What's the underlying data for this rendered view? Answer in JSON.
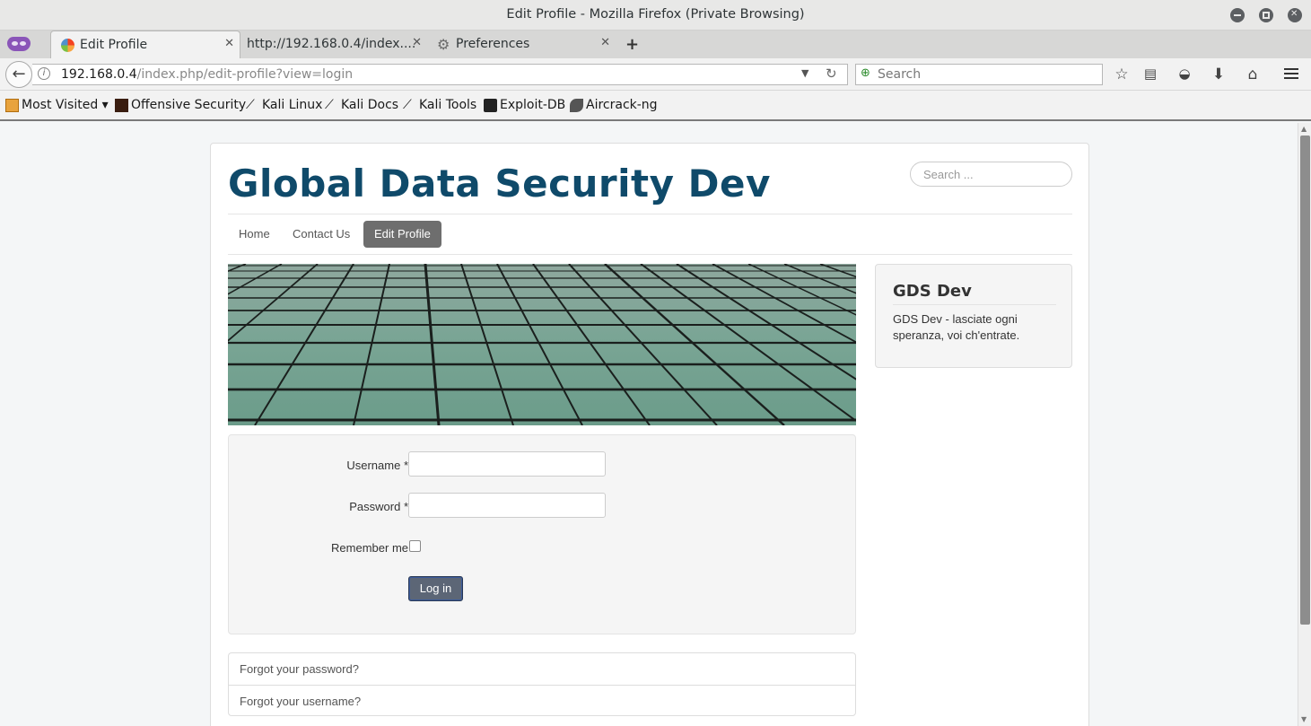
{
  "window": {
    "title": "Edit Profile - Mozilla Firefox (Private Browsing)"
  },
  "tabs": [
    {
      "label": "Edit Profile",
      "icon": "joomla-icon",
      "active": true
    },
    {
      "label": "http://192.168.0.4/index....",
      "active": false
    },
    {
      "label": "Preferences",
      "icon": "gear-icon",
      "active": false
    }
  ],
  "navbar": {
    "url_host": "192.168.0.4",
    "url_rest": "/index.php/edit-profile?view=login",
    "search_placeholder": "Search"
  },
  "bookmarks": [
    {
      "label": "Most Visited ▾",
      "icon": "most-visited-icon"
    },
    {
      "label": "Offensive Security",
      "icon": "offensive-security-icon"
    },
    {
      "label": "Kali Linux",
      "icon": "kali-dragon-icon"
    },
    {
      "label": "Kali Docs",
      "icon": "kali-dragon-icon"
    },
    {
      "label": "Kali Tools",
      "icon": "kali-dragon-icon"
    },
    {
      "label": "Exploit-DB",
      "icon": "exploit-db-icon"
    },
    {
      "label": "Aircrack-ng",
      "icon": "aircrack-icon"
    }
  ],
  "site": {
    "title": "Global Data Security Dev",
    "search_placeholder": "Search ...",
    "menu": [
      "Home",
      "Contact Us",
      "Edit Profile"
    ],
    "active_menu": "Edit Profile"
  },
  "login": {
    "username_label": "Username *",
    "password_label": "Password *",
    "remember_label": "Remember me",
    "login_button": "Log in",
    "username_value": "",
    "password_value": "",
    "remember_checked": false
  },
  "links": [
    "Forgot your password?",
    "Forgot your username?"
  ],
  "sidebar": {
    "heading": "GDS Dev",
    "text": "GDS Dev - lasciate ogni speranza, voi ch'entrate."
  },
  "colors": {
    "brand": "#0f4a6a",
    "active_menu_bg": "#6e6e6e",
    "button_bg": "#5c6676"
  }
}
